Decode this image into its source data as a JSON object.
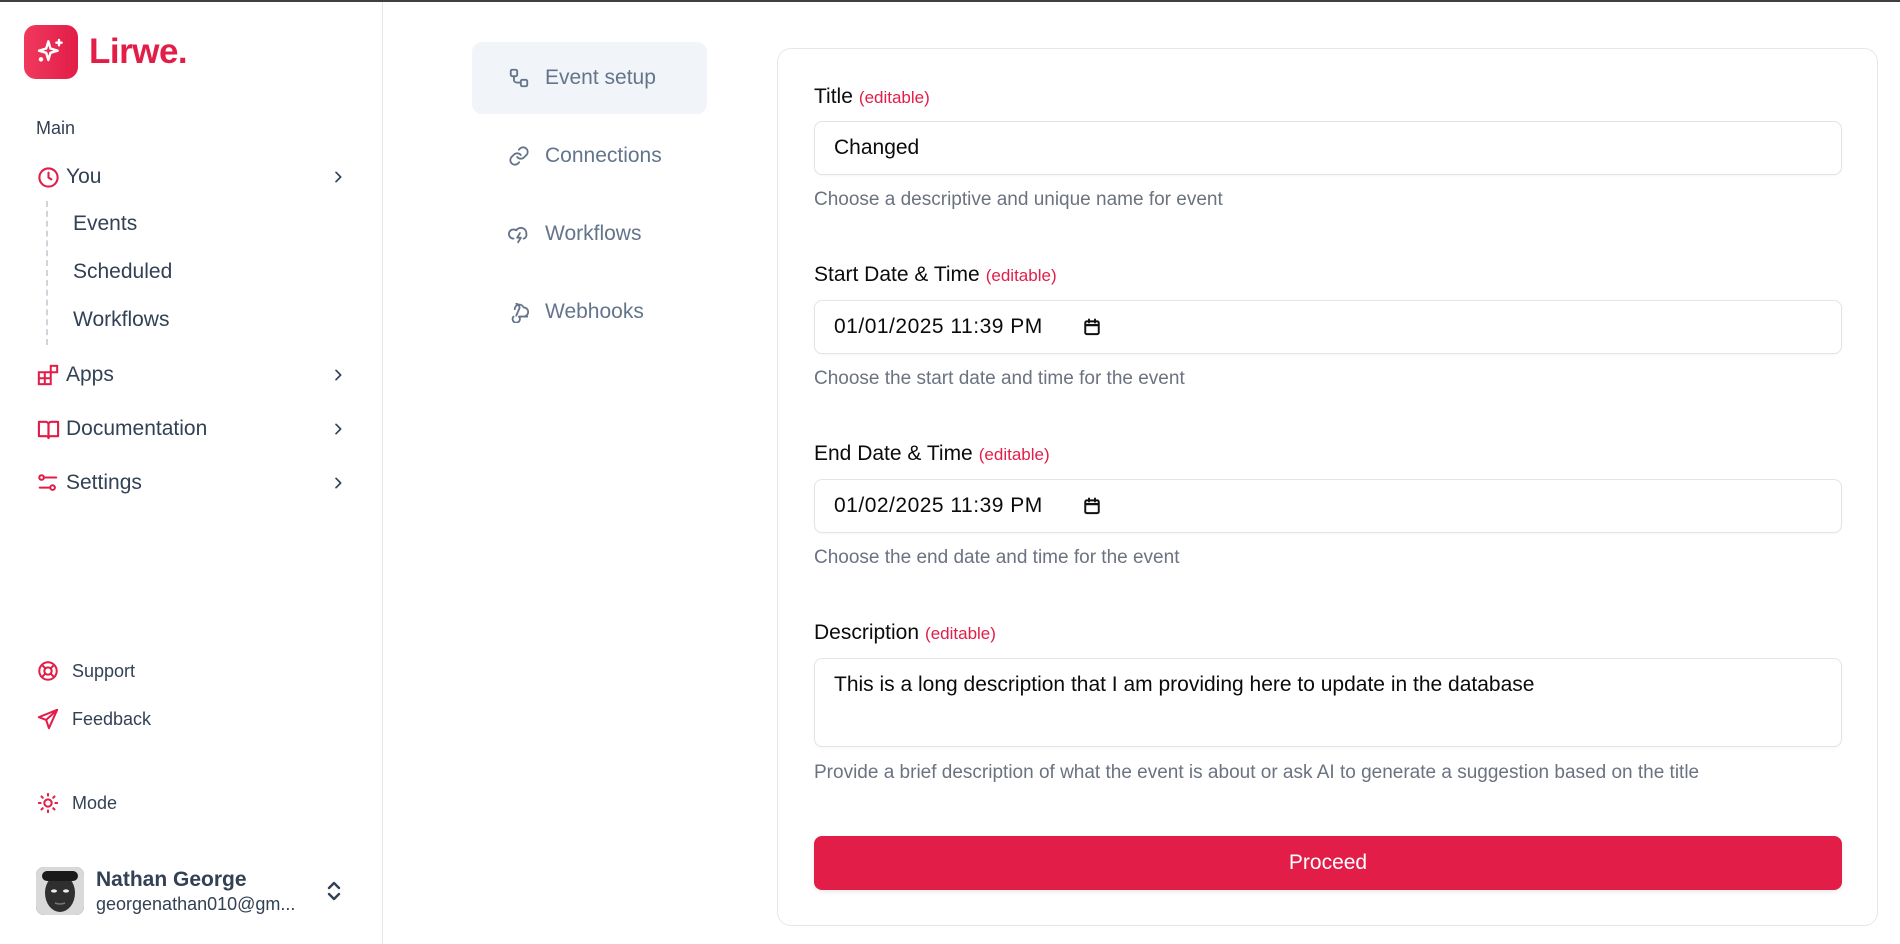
{
  "brand": {
    "name": "Lirwe.",
    "icon": "sparkles-icon",
    "color": "#e11d48"
  },
  "sidebar": {
    "section_label": "Main",
    "items": [
      {
        "label": "You",
        "icon": "clock-icon",
        "expanded": true,
        "children": [
          {
            "label": "Events"
          },
          {
            "label": "Scheduled"
          },
          {
            "label": "Workflows"
          }
        ]
      },
      {
        "label": "Apps",
        "icon": "apps-icon"
      },
      {
        "label": "Documentation",
        "icon": "book-open-icon"
      },
      {
        "label": "Settings",
        "icon": "sliders-icon"
      }
    ],
    "footer": [
      {
        "label": "Support",
        "icon": "life-buoy-icon"
      },
      {
        "label": "Feedback",
        "icon": "send-icon"
      },
      {
        "label": "Mode",
        "icon": "sun-icon"
      }
    ],
    "user": {
      "name": "Nathan George",
      "email": "georgenathan010@gm..."
    }
  },
  "subnav": {
    "active": "Event setup",
    "items": [
      {
        "label": "Event setup",
        "icon": "workflow-icon"
      },
      {
        "label": "Connections",
        "icon": "link-icon"
      },
      {
        "label": "Workflows",
        "icon": "cloud-lightning-icon"
      },
      {
        "label": "Webhooks",
        "icon": "webhook-icon"
      }
    ]
  },
  "form": {
    "editable_tag": "(editable)",
    "title": {
      "label": "Title",
      "value": "Changed",
      "help": "Choose a descriptive and unique name for event"
    },
    "start": {
      "label": "Start Date & Time",
      "value": "01/01/2025 11:39 PM",
      "help": "Choose the start date and time for the event"
    },
    "end": {
      "label": "End Date & Time",
      "value": "01/02/2025 11:39 PM",
      "help": "Choose the end date and time for the event"
    },
    "description": {
      "label": "Description",
      "value": "This is a long description that I am providing here to update in the database",
      "help": "Provide a brief description of what the event is about or ask AI to generate a suggestion based on the title"
    },
    "submit_label": "Proceed"
  }
}
